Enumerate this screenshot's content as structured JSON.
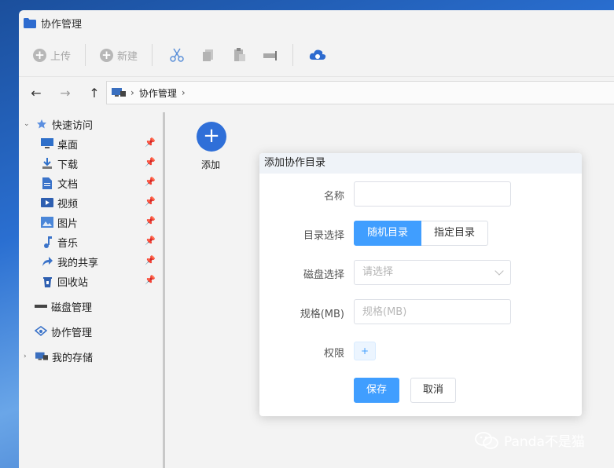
{
  "window": {
    "title": "协作管理"
  },
  "toolbar": {
    "upload_label": "上传",
    "new_label": "新建"
  },
  "address": {
    "path_label": "协作管理"
  },
  "sidebar": {
    "quick_access": "快速访问",
    "items": [
      {
        "label": "桌面"
      },
      {
        "label": "下载"
      },
      {
        "label": "文档"
      },
      {
        "label": "视频"
      },
      {
        "label": "图片"
      },
      {
        "label": "音乐"
      },
      {
        "label": "我的共享"
      },
      {
        "label": "回收站"
      }
    ],
    "disk": "磁盘管理",
    "collab": "协作管理",
    "storage": "我的存储"
  },
  "content": {
    "add_label": "添加"
  },
  "dialog": {
    "title": "添加协作目录",
    "name_label": "名称",
    "dir_label": "目录选择",
    "dir_options": [
      "随机目录",
      "指定目录"
    ],
    "disk_label": "磁盘选择",
    "disk_placeholder": "请选择",
    "spec_label": "规格(MB)",
    "spec_placeholder": "规格(MB)",
    "perm_label": "权限",
    "perm_add": "+",
    "save_label": "保存",
    "cancel_label": "取消"
  },
  "watermark": {
    "text": "Panda不是猫"
  },
  "colors": {
    "primary": "#409eff",
    "accent_blue": "#2f6fd8"
  }
}
